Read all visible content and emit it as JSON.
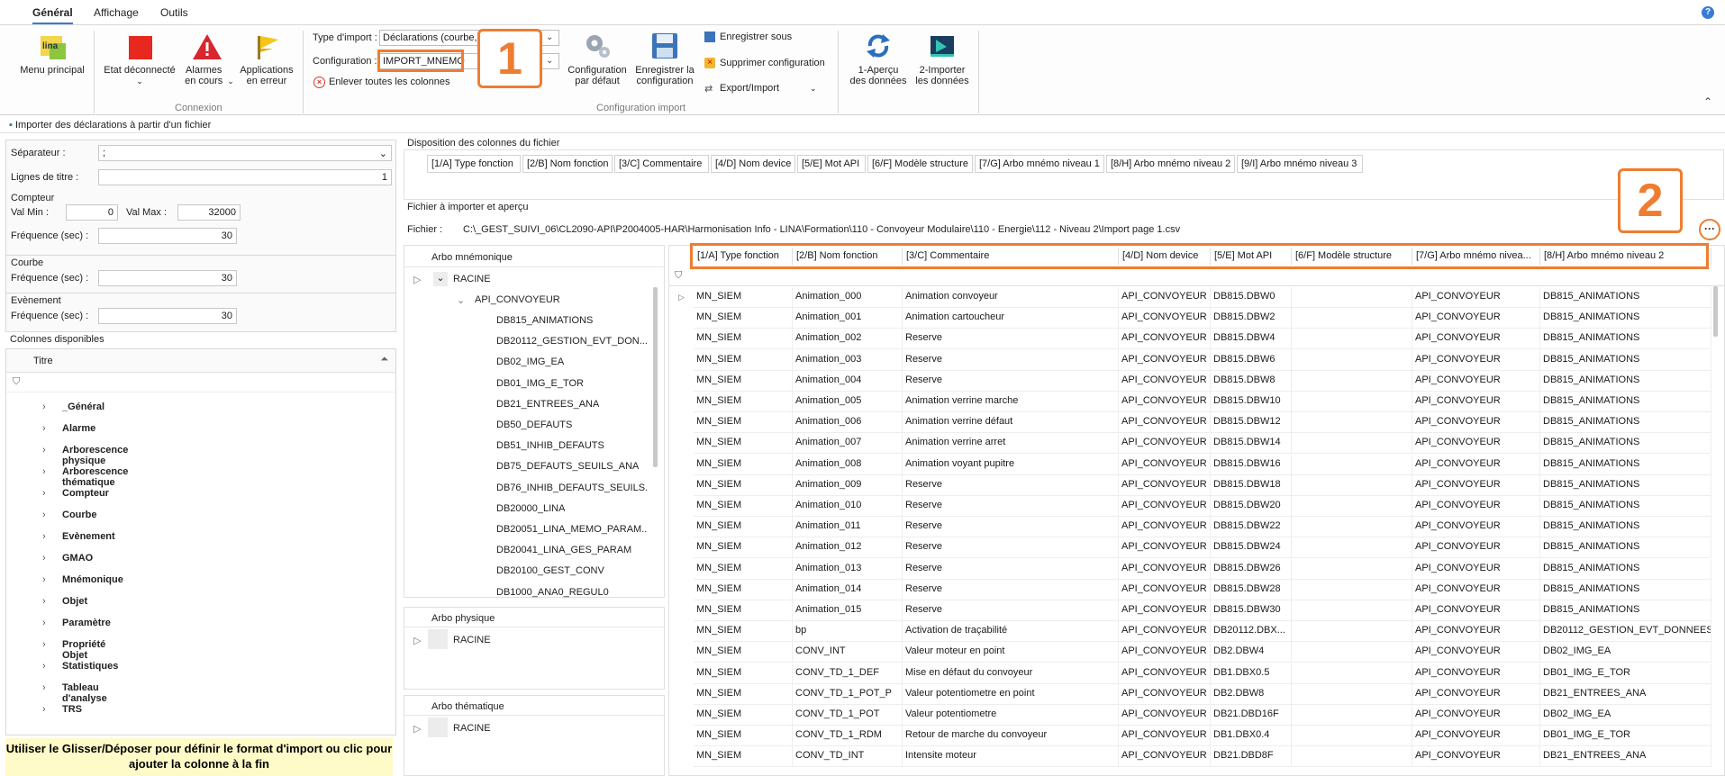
{
  "tabs": [
    "Général",
    "Affichage",
    "Outils"
  ],
  "help_icon": "help-icon",
  "ribbon": {
    "menu_principal": "Menu principal",
    "etat": "Etat déconnecté",
    "alarmes": "Alarmes en cours",
    "applications": "Applications en erreur",
    "connexion_label": "Connexion",
    "type_import_label": "Type d'import :",
    "type_import_value": "Déclarations (courbe,",
    "configuration_label": "Configuration :",
    "configuration_value": "IMPORT_MNEMO",
    "enlever": "Enlever toutes les colonnes",
    "config_defaut": "Configuration par défaut",
    "enregistrer_config": "Enregistrer la configuration",
    "enregistrer_sous": "Enregistrer sous",
    "supprimer_config": "Supprimer configuration",
    "export_import": "Export/Import",
    "config_import_label": "Configuration import",
    "apercu": "1-Aperçu des données",
    "importer": "2-Importer les données",
    "badge1": "1",
    "badge2": "2"
  },
  "subbar_title": "Importer des déclarations à partir d'un fichier",
  "left": {
    "separateur_label": "Séparateur :",
    "separateur_value": ";",
    "lignes_titre_label": "Lignes de titre :",
    "lignes_titre_value": "1",
    "compteur": "Compteur",
    "val_min_label": "Val Min :",
    "val_min": "0",
    "val_max_label": "Val Max :",
    "val_max": "32000",
    "freq_label": "Fréquence (sec) :",
    "freq_compteur": "30",
    "courbe": "Courbe",
    "freq_courbe": "30",
    "evenement": "Evènement",
    "freq_evenement": "30",
    "colonnes_dispo": "Colonnes disponibles",
    "titre_col": "Titre",
    "tree": [
      "_Général",
      "Alarme",
      "Arborescence physique",
      "Arborescence thématique",
      "Compteur",
      "Courbe",
      "Evènement",
      "GMAO",
      "Mnémonique",
      "Objet",
      "Paramètre",
      "Propriété Objet",
      "Statistiques",
      "Tableau d'analyse",
      "TRS"
    ],
    "hint": "Utiliser le Glisser/Déposer pour définir le format d'import ou clic pour ajouter la colonne à la fin"
  },
  "disposition_title": "Disposition des colonnes du fichier",
  "disposition_cols": [
    "[1/A] Type fonction",
    "[2/B] Nom fonction",
    "[3/C] Commentaire",
    "[4/D] Nom device",
    "[5/E] Mot API",
    "[6/F] Modèle structure",
    "[7/G] Arbo mnémo niveau 1",
    "[8/H] Arbo mnémo niveau 2",
    "[9/I] Arbo mnémo niveau 3"
  ],
  "fichier_section": "Fichier à importer et aperçu",
  "fichier_label": "Fichier :",
  "fichier_path": "C:\\_GEST_SUIVI_06\\CL2090-API\\P2004005-HAR\\Harmonisation Info - LINA\\Formation\\110 - Convoyeur Modulaire\\110 - Energie\\112 - Niveau 2\\Import page 1.csv",
  "arbo_mnemo_title": "Arbo mnémonique",
  "arbo_mnemo_root": "RACINE",
  "arbo_mnemo_child": "API_CONVOYEUR",
  "arbo_mnemo_nodes": [
    "DB815_ANIMATIONS",
    "DB20112_GESTION_EVT_DON...",
    "DB02_IMG_EA",
    "DB01_IMG_E_TOR",
    "DB21_ENTREES_ANA",
    "DB50_DEFAUTS",
    "DB51_INHIB_DEFAUTS",
    "DB75_DEFAUTS_SEUILS_ANA",
    "DB76_INHIB_DEFAUTS_SEUILS...",
    "DB20000_LINA",
    "DB20051_LINA_MEMO_PARAM...",
    "DB20041_LINA_GES_PARAM",
    "DB20100_GEST_CONV",
    "DB1000_ANA0_REGUL0"
  ],
  "arbo_phys_title": "Arbo physique",
  "arbo_phys_root": "RACINE",
  "arbo_them_title": "Arbo thématique",
  "arbo_them_root": "RACINE",
  "grid": {
    "headers": [
      "[1/A] Type fonction",
      "[2/B] Nom fonction",
      "[3/C] Commentaire",
      "[4/D] Nom device",
      "[5/E] Mot API",
      "[6/F] Modèle structure",
      "[7/G] Arbo mnémo nivea...",
      "[8/H] Arbo mnémo niveau 2"
    ],
    "rows": [
      [
        "MN_SIEM",
        "Animation_000",
        "Animation convoyeur",
        "API_CONVOYEUR",
        "DB815.DBW0",
        "",
        "API_CONVOYEUR",
        "DB815_ANIMATIONS"
      ],
      [
        "MN_SIEM",
        "Animation_001",
        "Animation cartoucheur",
        "API_CONVOYEUR",
        "DB815.DBW2",
        "",
        "API_CONVOYEUR",
        "DB815_ANIMATIONS"
      ],
      [
        "MN_SIEM",
        "Animation_002",
        "Reserve",
        "API_CONVOYEUR",
        "DB815.DBW4",
        "",
        "API_CONVOYEUR",
        "DB815_ANIMATIONS"
      ],
      [
        "MN_SIEM",
        "Animation_003",
        "Reserve",
        "API_CONVOYEUR",
        "DB815.DBW6",
        "",
        "API_CONVOYEUR",
        "DB815_ANIMATIONS"
      ],
      [
        "MN_SIEM",
        "Animation_004",
        "Reserve",
        "API_CONVOYEUR",
        "DB815.DBW8",
        "",
        "API_CONVOYEUR",
        "DB815_ANIMATIONS"
      ],
      [
        "MN_SIEM",
        "Animation_005",
        "Animation verrine marche",
        "API_CONVOYEUR",
        "DB815.DBW10",
        "",
        "API_CONVOYEUR",
        "DB815_ANIMATIONS"
      ],
      [
        "MN_SIEM",
        "Animation_006",
        "Animation verrine défaut",
        "API_CONVOYEUR",
        "DB815.DBW12",
        "",
        "API_CONVOYEUR",
        "DB815_ANIMATIONS"
      ],
      [
        "MN_SIEM",
        "Animation_007",
        "Animation verrine arret",
        "API_CONVOYEUR",
        "DB815.DBW14",
        "",
        "API_CONVOYEUR",
        "DB815_ANIMATIONS"
      ],
      [
        "MN_SIEM",
        "Animation_008",
        "Animation voyant pupitre",
        "API_CONVOYEUR",
        "DB815.DBW16",
        "",
        "API_CONVOYEUR",
        "DB815_ANIMATIONS"
      ],
      [
        "MN_SIEM",
        "Animation_009",
        "Reserve",
        "API_CONVOYEUR",
        "DB815.DBW18",
        "",
        "API_CONVOYEUR",
        "DB815_ANIMATIONS"
      ],
      [
        "MN_SIEM",
        "Animation_010",
        "Reserve",
        "API_CONVOYEUR",
        "DB815.DBW20",
        "",
        "API_CONVOYEUR",
        "DB815_ANIMATIONS"
      ],
      [
        "MN_SIEM",
        "Animation_011",
        "Reserve",
        "API_CONVOYEUR",
        "DB815.DBW22",
        "",
        "API_CONVOYEUR",
        "DB815_ANIMATIONS"
      ],
      [
        "MN_SIEM",
        "Animation_012",
        "Reserve",
        "API_CONVOYEUR",
        "DB815.DBW24",
        "",
        "API_CONVOYEUR",
        "DB815_ANIMATIONS"
      ],
      [
        "MN_SIEM",
        "Animation_013",
        "Reserve",
        "API_CONVOYEUR",
        "DB815.DBW26",
        "",
        "API_CONVOYEUR",
        "DB815_ANIMATIONS"
      ],
      [
        "MN_SIEM",
        "Animation_014",
        "Reserve",
        "API_CONVOYEUR",
        "DB815.DBW28",
        "",
        "API_CONVOYEUR",
        "DB815_ANIMATIONS"
      ],
      [
        "MN_SIEM",
        "Animation_015",
        "Reserve",
        "API_CONVOYEUR",
        "DB815.DBW30",
        "",
        "API_CONVOYEUR",
        "DB815_ANIMATIONS"
      ],
      [
        "MN_SIEM",
        "bp",
        "Activation de traçabilité",
        "API_CONVOYEUR",
        "DB20112.DBX...",
        "",
        "API_CONVOYEUR",
        "DB20112_GESTION_EVT_DONNEES"
      ],
      [
        "MN_SIEM",
        "CONV_INT",
        "Valeur moteur en point",
        "API_CONVOYEUR",
        "DB2.DBW4",
        "",
        "API_CONVOYEUR",
        "DB02_IMG_EA"
      ],
      [
        "MN_SIEM",
        "CONV_TD_1_DEF",
        "Mise en défaut du convoyeur",
        "API_CONVOYEUR",
        "DB1.DBX0.5",
        "",
        "API_CONVOYEUR",
        "DB01_IMG_E_TOR"
      ],
      [
        "MN_SIEM",
        "CONV_TD_1_POT_P",
        "Valeur potentiometre en point",
        "API_CONVOYEUR",
        "DB2.DBW8",
        "",
        "API_CONVOYEUR",
        "DB21_ENTREES_ANA"
      ],
      [
        "MN_SIEM",
        "CONV_TD_1_POT",
        "Valeur potentiometre",
        "API_CONVOYEUR",
        "DB21.DBD16F",
        "",
        "API_CONVOYEUR",
        "DB02_IMG_EA"
      ],
      [
        "MN_SIEM",
        "CONV_TD_1_RDM",
        "Retour de marche du convoyeur",
        "API_CONVOYEUR",
        "DB1.DBX0.4",
        "",
        "API_CONVOYEUR",
        "DB01_IMG_E_TOR"
      ],
      [
        "MN_SIEM",
        "CONV_TD_INT",
        "Intensite moteur",
        "API_CONVOYEUR",
        "DB21.DBD8F",
        "",
        "API_CONVOYEUR",
        "DB21_ENTREES_ANA"
      ]
    ]
  }
}
